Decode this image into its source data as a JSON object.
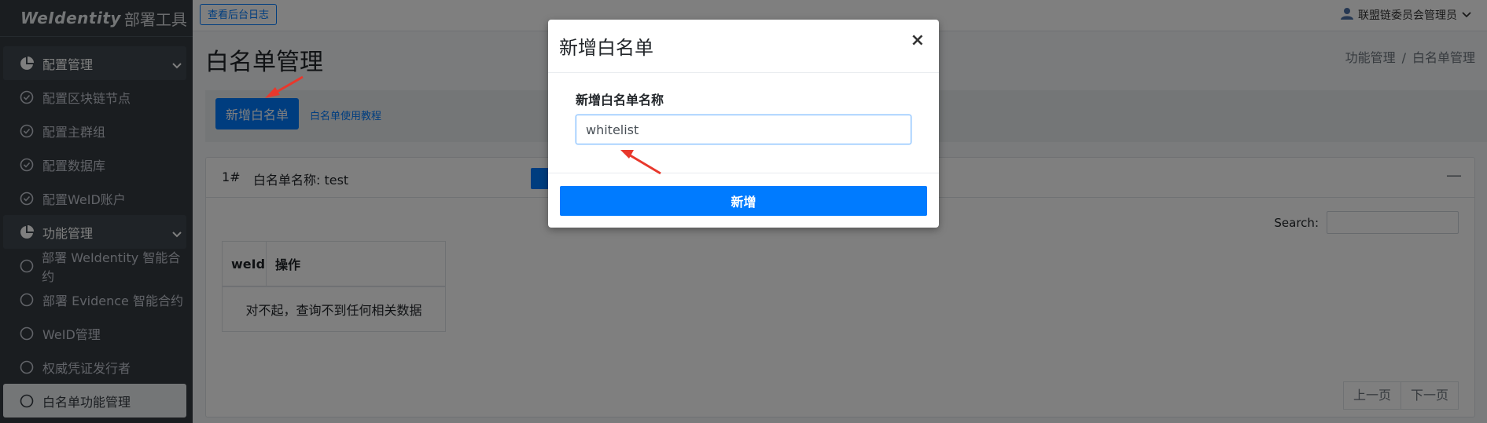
{
  "sidebar": {
    "brand_logo": "WeIdentity",
    "brand_sub": "部署工具",
    "items": [
      {
        "label": "配置管理",
        "type": "header",
        "icon": "pie-chart-icon"
      },
      {
        "label": "配置区块链节点",
        "type": "item",
        "icon": "check-circle-icon"
      },
      {
        "label": "配置主群组",
        "type": "item",
        "icon": "check-circle-icon"
      },
      {
        "label": "配置数据库",
        "type": "item",
        "icon": "check-circle-icon"
      },
      {
        "label": "配置WeID账户",
        "type": "item",
        "icon": "check-circle-icon"
      },
      {
        "label": "功能管理",
        "type": "header",
        "icon": "pie-chart-icon"
      },
      {
        "label": "部署 WeIdentity 智能合约",
        "type": "item",
        "icon": "circle-icon"
      },
      {
        "label": "部署 Evidence 智能合约",
        "type": "item",
        "icon": "circle-icon"
      },
      {
        "label": "WeID管理",
        "type": "item",
        "icon": "circle-icon"
      },
      {
        "label": "权威凭证发行者",
        "type": "item",
        "icon": "circle-icon"
      },
      {
        "label": "白名单功能管理",
        "type": "item",
        "icon": "circle-icon",
        "active": true
      }
    ]
  },
  "topbar": {
    "log_button": "查看后台日志",
    "user_name": "联盟链委员会管理员"
  },
  "main": {
    "title": "白名单管理",
    "breadcrumb": [
      "功能管理",
      "/",
      "白名单管理"
    ],
    "add_button": "新增白名单",
    "tutorial_link": "白名单使用教程",
    "card": {
      "number": "1#",
      "name": "白名单名称: test",
      "search_label": "Search:",
      "columns": [
        "weId",
        "操作"
      ],
      "empty_text": "对不起，查询不到任何相关数据",
      "prev": "上一页",
      "next": "下一页"
    }
  },
  "modal": {
    "title": "新增白名单",
    "close": "×",
    "field_label": "新增白名单名称",
    "field_value": "whitelist",
    "submit": "新增"
  },
  "colors": {
    "primary": "#007bff",
    "sidebar_bg": "#343a40",
    "arrow": "#e8382c"
  }
}
